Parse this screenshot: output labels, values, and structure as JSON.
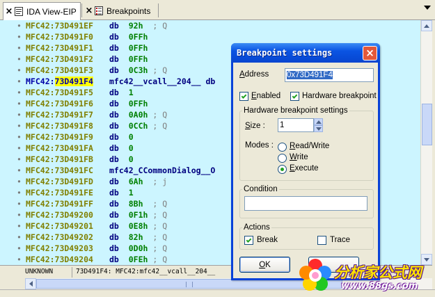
{
  "tabs": [
    {
      "label": "IDA View-EIP",
      "close": "×",
      "icon": "ida-view-icon"
    },
    {
      "label": "Breakpoints",
      "close": "×",
      "icon": "breakpoints-icon"
    }
  ],
  "disasm": {
    "rows": [
      {
        "addr": "MFC42:73D491EF",
        "instr": "db",
        "operand": "92h",
        "comment": "; Q"
      },
      {
        "addr": "MFC42:73D491F0",
        "instr": "db",
        "operand": "0FFh",
        "comment": ""
      },
      {
        "addr": "MFC42:73D491F1",
        "instr": "db",
        "operand": "0FFh",
        "comment": ""
      },
      {
        "addr": "MFC42:73D491F2",
        "instr": "db",
        "operand": "0FFh",
        "comment": ""
      },
      {
        "addr": "MFC42:73D491F3",
        "instr": "db",
        "operand": "0C3h",
        "comment": "; Q"
      },
      {
        "addr_prefix": "MFC42:",
        "addr_highlight": "73D491F4",
        "instr": "mfc42__vcall__204__ db",
        "operand": "",
        "comment": "",
        "current": true
      },
      {
        "addr": "MFC42:73D491F5",
        "instr": "db",
        "operand": "1",
        "comment": ""
      },
      {
        "addr": "MFC42:73D491F6",
        "instr": "db",
        "operand": "0FFh",
        "comment": ""
      },
      {
        "addr": "MFC42:73D491F7",
        "instr": "db",
        "operand": "0A0h",
        "comment": "; Q"
      },
      {
        "addr": "MFC42:73D491F8",
        "instr": "db",
        "operand": "0CCh",
        "comment": "; Q"
      },
      {
        "addr": "MFC42:73D491F9",
        "instr": "db",
        "operand": "0",
        "comment": ""
      },
      {
        "addr": "MFC42:73D491FA",
        "instr": "db",
        "operand": "0",
        "comment": ""
      },
      {
        "addr": "MFC42:73D491FB",
        "instr": "db",
        "operand": "0",
        "comment": ""
      },
      {
        "addr": "MFC42:73D491FC",
        "instr": "mfc42_CCommonDialog__O",
        "operand": "",
        "comment": ""
      },
      {
        "addr": "MFC42:73D491FD",
        "instr": "db",
        "operand": "6Ah",
        "comment": "; j"
      },
      {
        "addr": "MFC42:73D491FE",
        "instr": "db",
        "operand": "1",
        "comment": ""
      },
      {
        "addr": "MFC42:73D491FF",
        "instr": "db",
        "operand": "8Bh",
        "comment": "; Q"
      },
      {
        "addr": "MFC42:73D49200",
        "instr": "db",
        "operand": "0F1h",
        "comment": "; Q"
      },
      {
        "addr": "MFC42:73D49201",
        "instr": "db",
        "operand": "0E8h",
        "comment": "; Q"
      },
      {
        "addr": "MFC42:73D49202",
        "instr": "db",
        "operand": "82h",
        "comment": "; Q"
      },
      {
        "addr": "MFC42:73D49203",
        "instr": "db",
        "operand": "0D0h",
        "comment": "; Q"
      },
      {
        "addr": "MFC42:73D49204",
        "instr": "db",
        "operand": "0FEh",
        "comment": "; Q"
      }
    ],
    "bullet": "•"
  },
  "status": {
    "left": "UNKNOWN",
    "right": "73D491F4: MFC42:mfc42__vcall__204__"
  },
  "dialog": {
    "title": "Breakpoint settings",
    "close": "×",
    "address_label": "Address",
    "address_value": "0x73D491F4",
    "enabled_label": "Enabled",
    "enabled_checked": true,
    "hw_label": "Hardware breakpoint",
    "hw_checked": true,
    "hw_group_title": "Hardware breakpoint settings",
    "size_label": "Size :",
    "size_value": "1",
    "modes_label": "Modes :",
    "modes": [
      {
        "label": "Read/Write",
        "selected": false
      },
      {
        "label": "Write",
        "selected": false
      },
      {
        "label": "Execute",
        "selected": true
      }
    ],
    "condition_title": "Condition",
    "condition_value": "",
    "actions_title": "Actions",
    "break_label": "Break",
    "break_checked": true,
    "trace_label": "Trace",
    "trace_checked": false,
    "ok_label": "OK"
  },
  "watermark": {
    "text": "分析家公式网",
    "url": "www.88gs.com",
    "logo_colors": [
      "#ff2a2a",
      "#2a8aff",
      "#22c822",
      "#ffd400",
      "#ff8a00"
    ]
  },
  "colors": {
    "disasm_bg": "#ccf5ff",
    "address": "#808000",
    "instruction": "#000080",
    "operand": "#008000",
    "highlight": "#ffff00",
    "title_bar": "#0a54e3"
  }
}
